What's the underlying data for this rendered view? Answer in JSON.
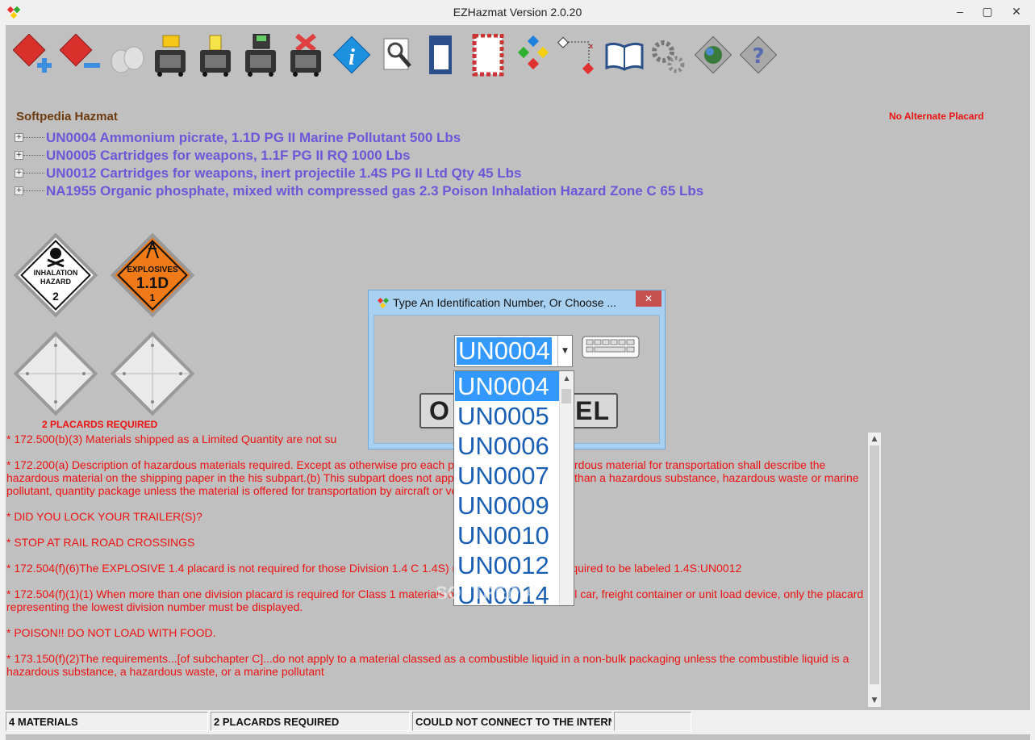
{
  "window": {
    "title": "EZHazmat Version 2.0.20",
    "min": "–",
    "max": "▢",
    "close": "✕"
  },
  "header": {
    "company": "Softpedia Hazmat",
    "alternate": "No Alternate Placard"
  },
  "materials": [
    "UN0004 Ammonium picrate, 1.1D PG II  Marine Pollutant 500 Lbs",
    "UN0005 Cartridges for weapons, 1.1F PG II RQ 1000 Lbs",
    "UN0012 Cartridges for weapons, inert projectile 1.4S PG II  Ltd Qty 45 Lbs",
    "NA1955 Organic phosphate, mixed with compressed gas 2.3  Poison Inhalation Hazard Zone C 65 Lbs"
  ],
  "placards": {
    "inhalation": {
      "line1": "INHALATION",
      "line2": "HAZARD",
      "num": "2"
    },
    "explosives": {
      "line1": "EXPLOSIVES",
      "line2": "1.1D",
      "num": "1"
    },
    "required": "2 PLACARDS REQUIRED"
  },
  "notes": [
    "* 172.500(b)(3) Materials shipped as a Limited Quantity are not su",
    "* 172.200(a) Description of hazardous materials required. Except as otherwise pro                   each person who offers a hazardous material for transportation shall describe the hazardous material on the shipping paper in the                  his subpart.(b) This subpart does not apply to any material, other than a hazardous substance, hazardous waste or marine pollutant,                 quantity package unless the material is offered for transportation by aircraft or vessel...",
    "* DID YOU LOCK YOUR TRAILER(S)?",
    "* STOP AT RAIL ROAD CROSSINGS",
    "* 172.504(f)(6)The EXPLOSIVE 1.4 placard is not required for those Division 1.4 C                   1.4S) materials that are not required to be labeled 1.4S:UN0012",
    "* 172.504(f)(1)(1) When more than one division placard is required for Class 1 materials on a transport vehicle, rail car, freight container or unit load device, only the placard representing the lowest division number must be displayed.",
    "* POISON!! DO NOT LOAD WITH FOOD.",
    "* 173.150(f)(2)The requirements...[of subchapter C]...do not apply to a material classed as a combustible liquid in a non-bulk packaging unless the combustible liquid is a hazardous substance, a hazardous waste, or a marine pollutant"
  ],
  "status": [
    "4 MATERIALS",
    "2 PLACARDS REQUIRED",
    "COULD NOT CONNECT TO THE INTERNE",
    ""
  ],
  "dialog": {
    "title": "Type An Identification Number, Or Choose ...",
    "close": "✕",
    "value": "UN0004",
    "ok_label": "O",
    "cancel_label": "CEL",
    "options": [
      "UN0004",
      "UN0005",
      "UN0006",
      "UN0007",
      "UN0009",
      "UN0010",
      "UN0012",
      "UN0014"
    ]
  },
  "watermark": "SOFTPEDIA"
}
